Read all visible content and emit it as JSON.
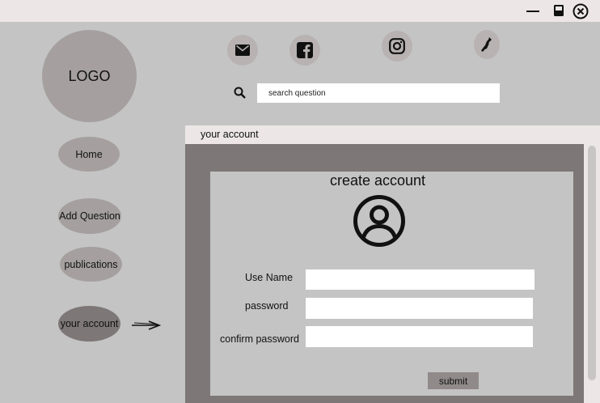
{
  "window": {
    "minimize_icon": "minimize-icon",
    "maximize_icon": "maximize-icon",
    "close_icon": "close-icon"
  },
  "sidebar": {
    "logo_text": "LOGO",
    "items": [
      {
        "label": "Home"
      },
      {
        "label": "Add Question"
      },
      {
        "label": "publications"
      },
      {
        "label": "your account",
        "active": true
      }
    ]
  },
  "header": {
    "social_icons": [
      "mail-icon",
      "facebook-icon",
      "instagram-icon",
      "phone-icon"
    ],
    "search": {
      "placeholder": "search question"
    }
  },
  "section": {
    "title": "your account"
  },
  "form": {
    "title": "create account",
    "fields": [
      {
        "label": "Use Name",
        "value": ""
      },
      {
        "label": "password",
        "value": ""
      },
      {
        "label": "confirm password",
        "value": ""
      }
    ],
    "submit_label": "submit"
  },
  "colors": {
    "background": "#c4c4c4",
    "titlebar": "#ece6e6",
    "pill": "#a59f9f",
    "pill_active": "#7d7777",
    "frame": "#7d7777",
    "submit": "#918a8a"
  }
}
